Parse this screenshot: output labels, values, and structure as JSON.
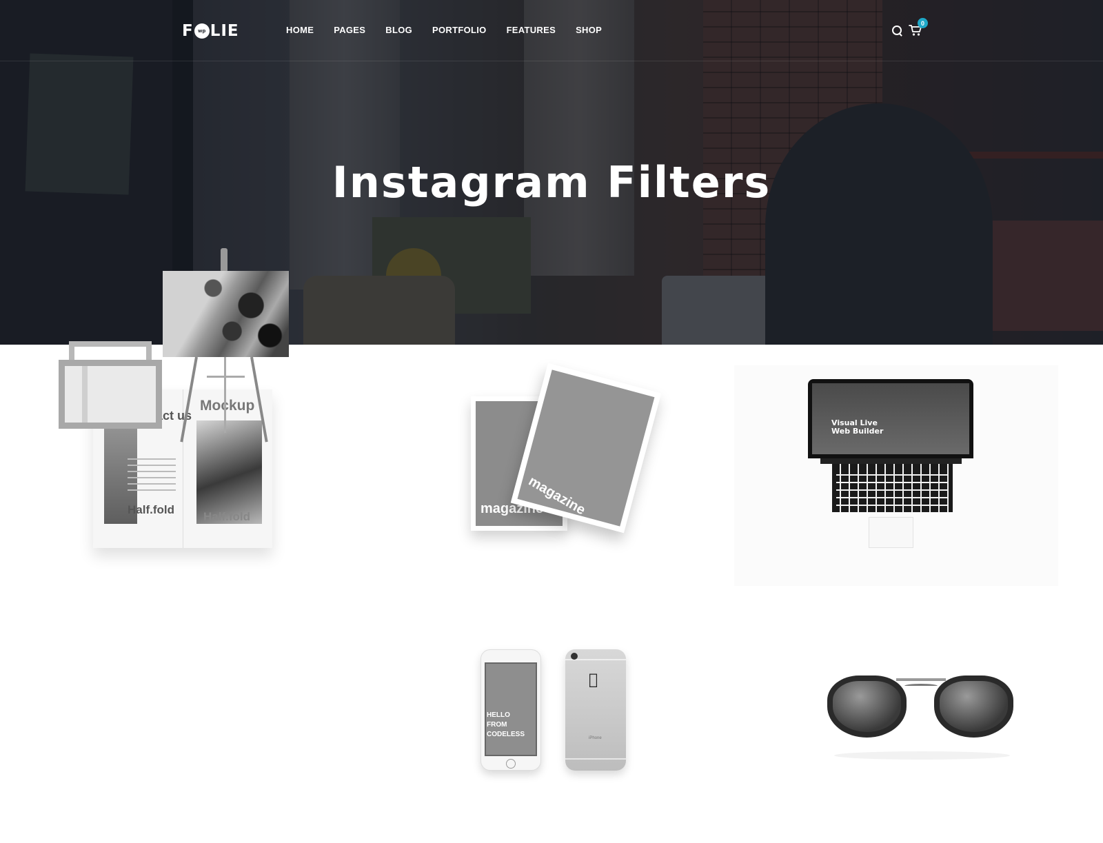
{
  "header": {
    "logo_text_left": "F",
    "logo_badge": "wp",
    "logo_text_right": "LIE",
    "nav": [
      "HOME",
      "PAGES",
      "BLOG",
      "PORTFOLIO",
      "FEATURES",
      "SHOP"
    ],
    "cart_count": "0"
  },
  "hero": {
    "title": "Instagram Filters"
  },
  "gallery": {
    "brochure": {
      "contact": "Contact us",
      "mockup": "Mockup",
      "halffold_left": "Half.fold",
      "halffold_right": "Half.fold"
    },
    "magazine": {
      "back_label": "magazine",
      "front_label": "magazine"
    },
    "laptop": {
      "headline_1": "Visual Live",
      "headline_2": "Web Builder"
    },
    "phones": {
      "screen_line_1": "HELLO",
      "screen_line_2": "FROM",
      "screen_line_3": "CODELESS",
      "back_model": "iPhone"
    }
  },
  "colors": {
    "accent_badge": "#1ea8c8",
    "hero_overlay": "#141820"
  }
}
